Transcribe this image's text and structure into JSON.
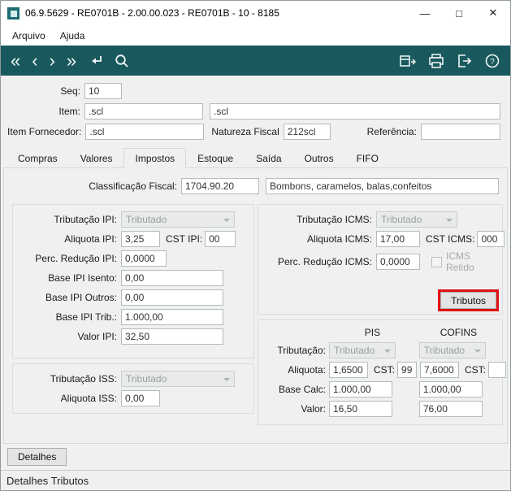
{
  "window": {
    "title": "06.9.5629 - RE0701B - 2.00.00.023 - RE0701B - 10 - 8185",
    "controls": {
      "minimize": "—",
      "maximize": "□",
      "close": "✕"
    }
  },
  "menu": {
    "items": [
      "Arquivo",
      "Ajuda"
    ]
  },
  "toolbar": {
    "nav_first": "«",
    "nav_prev": "‹",
    "nav_next": "›",
    "nav_last": "»"
  },
  "header": {
    "seq": {
      "label": "Seq:",
      "value": "10"
    },
    "item": {
      "label": "Item:",
      "value": ".scl",
      "desc": ".scl"
    },
    "item_fornecedor": {
      "label": "Item Fornecedor:",
      "value": ".scl"
    },
    "natureza_fiscal": {
      "label": "Natureza Fiscal",
      "value": "212scl"
    },
    "referencia": {
      "label": "Referência:",
      "value": ""
    }
  },
  "tabs": {
    "items": [
      "Compras",
      "Valores",
      "Impostos",
      "Estoque",
      "Saída",
      "Outros",
      "FIFO"
    ],
    "active": "Impostos"
  },
  "impostos": {
    "classificacao": {
      "label": "Classificação Fiscal:",
      "code": "1704.90.20",
      "desc": "Bombons, caramelos, balas,confeitos"
    },
    "ipi": {
      "tributacao_label": "Tributação IPI:",
      "tributacao": "Tributado",
      "aliquota_label": "Aliquota IPI:",
      "aliquota": "3,25",
      "cst_label": "CST IPI:",
      "cst": "00",
      "reducao_label": "Perc. Redução IPI:",
      "reducao": "0,0000",
      "base_isento_label": "Base IPI Isento:",
      "base_isento": "0,00",
      "base_outros_label": "Base IPI Outros:",
      "base_outros": "0,00",
      "base_trib_label": "Base IPI Trib.:",
      "base_trib": "1.000,00",
      "valor_label": "Valor IPI:",
      "valor": "32,50"
    },
    "iss": {
      "tributacao_label": "Tributação ISS:",
      "tributacao": "Tributado",
      "aliquota_label": "Aliquota ISS:",
      "aliquota": "0,00"
    },
    "icms": {
      "tributacao_label": "Tributação ICMS:",
      "tributacao": "Tributado",
      "aliquota_label": "Aliquota ICMS:",
      "aliquota": "17,00",
      "cst_label": "CST ICMS:",
      "cst": "000",
      "reducao_label": "Perc. Redução ICMS:",
      "reducao": "0,0000",
      "retido_label": "ICMS Retido",
      "tributos_button": "Tributos"
    },
    "pis_cofins": {
      "pis_header": "PIS",
      "cofins_header": "COFINS",
      "tributacao_label": "Tributação:",
      "pis_tributacao": "Tributado",
      "cofins_tributacao": "Tributado",
      "aliquota_label": "Aliquota:",
      "pis_aliquota": "1,6500",
      "pis_cst_label": "CST:",
      "pis_cst": "99",
      "cofins_aliquota": "7,6000",
      "cofins_cst_label": "CST:",
      "cofins_cst": "",
      "base_label": "Base Calc:",
      "pis_base": "1.000,00",
      "cofins_base": "1.000,00",
      "valor_label": "Valor:",
      "pis_valor": "16,50",
      "cofins_valor": "76,00"
    }
  },
  "footer": {
    "detalhes_button": "Detalhes",
    "status": "Detalhes Tributos"
  }
}
